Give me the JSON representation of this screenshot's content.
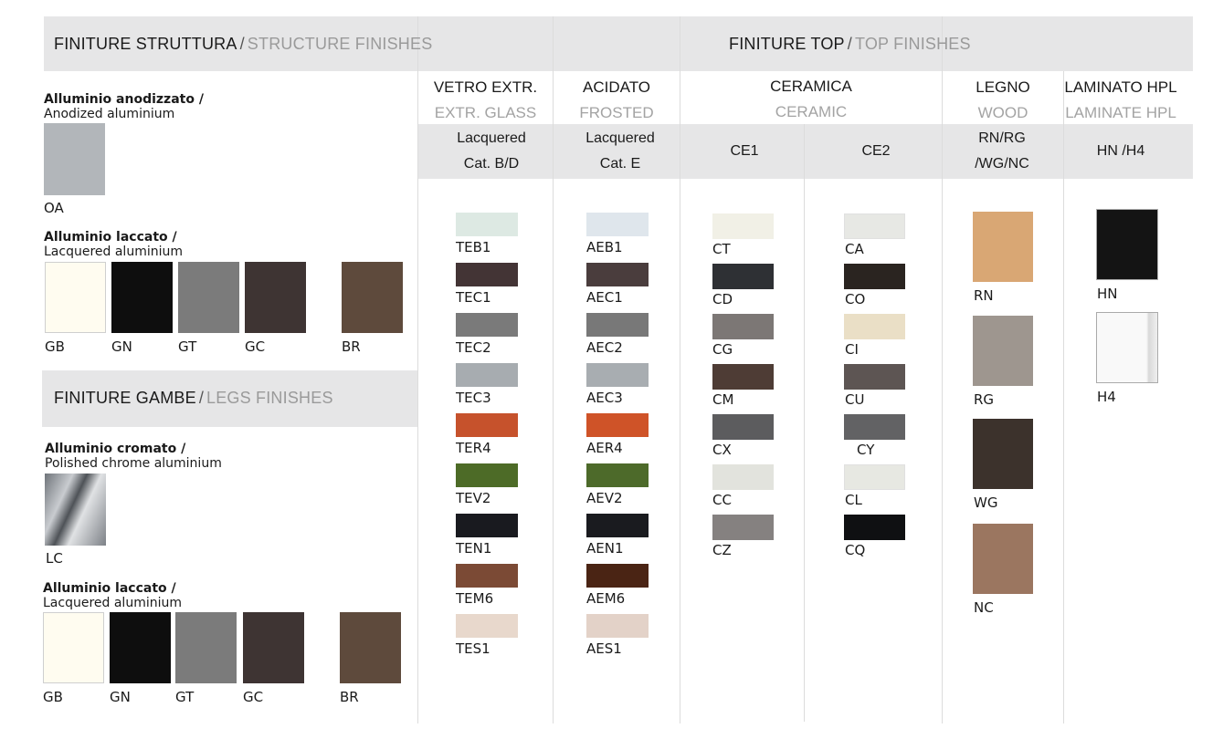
{
  "structure_header": {
    "it": "FINITURE STRUTTURA",
    "sep": "/",
    "en": "STRUCTURE FINISHES"
  },
  "legs_header": {
    "it": "FINITURE GAMBE",
    "sep": "/",
    "en": "LEGS FINISHES"
  },
  "top_header": {
    "it": "FINITURE TOP",
    "sep": "/",
    "en": "TOP FINISHES"
  },
  "groups": [
    {
      "it": "Alluminio anodizzato /",
      "en": "Anodized aluminium"
    },
    {
      "it": "Alluminio laccato /",
      "en": "Lacquered aluminium"
    },
    {
      "it": "Alluminio cromato /",
      "en": "Polished chrome aluminium"
    },
    {
      "it": "Alluminio laccato /",
      "en": "Lacquered aluminium"
    }
  ],
  "structure_swatches": [
    {
      "code": "OA",
      "color": "#b2b6ba"
    },
    {
      "code": "GB",
      "color": "#fffcf0"
    },
    {
      "code": "GN",
      "color": "#0e0e0e"
    },
    {
      "code": "GT",
      "color": "#7b7b7b"
    },
    {
      "code": "GC",
      "color": "#3e3433"
    },
    {
      "code": "BR",
      "color": "#5e4a3c"
    }
  ],
  "legs_swatches": [
    {
      "code": "LC",
      "color": "#8d9196"
    },
    {
      "code": "GB",
      "color": "#fffcf0"
    },
    {
      "code": "GN",
      "color": "#0e0e0e"
    },
    {
      "code": "GT",
      "color": "#7b7b7b"
    },
    {
      "code": "GC",
      "color": "#3e3433"
    },
    {
      "code": "BR",
      "color": "#5e4a3c"
    }
  ],
  "columns": [
    {
      "it": "VETRO EXTR.",
      "en": "EXTR. GLASS",
      "sub1": "Lacquered",
      "sub2": "Cat. B/D"
    },
    {
      "it": "ACIDATO",
      "en": "FROSTED",
      "sub1": "Lacquered",
      "sub2": "Cat. E"
    },
    {
      "it": "CERAMICA",
      "en": "CERAMIC",
      "sub1": "CE1",
      "sub2": "CE2"
    },
    {
      "it": "LEGNO",
      "en": "WOOD",
      "sub1": "RN/RG",
      "sub2": "/WG/NC"
    },
    {
      "it": "LAMINATO HPL",
      "en": "LAMINATE HPL",
      "sub1": "HN /H4",
      "sub2": ""
    }
  ],
  "glass": [
    {
      "code": "TEB1",
      "color": "#dde9e3"
    },
    {
      "code": "TEC1",
      "color": "#433435"
    },
    {
      "code": "TEC2",
      "color": "#7a7a7a"
    },
    {
      "code": "TEC3",
      "color": "#a7acb0"
    },
    {
      "code": "TER4",
      "color": "#c6522c"
    },
    {
      "code": "TEV2",
      "color": "#4d6b27"
    },
    {
      "code": "TEN1",
      "color": "#191a1f"
    },
    {
      "code": "TEM6",
      "color": "#7b4a35"
    },
    {
      "code": "TES1",
      "color": "#e8d8cc"
    }
  ],
  "frosted": [
    {
      "code": "AEB1",
      "color": "#dfe6ec"
    },
    {
      "code": "AEC1",
      "color": "#4a3d3d"
    },
    {
      "code": "AEC2",
      "color": "#787878"
    },
    {
      "code": "AEC3",
      "color": "#a8adb1"
    },
    {
      "code": "AER4",
      "color": "#cf5328"
    },
    {
      "code": "AEV2",
      "color": "#4d6a2a"
    },
    {
      "code": "AEN1",
      "color": "#1a1b1f"
    },
    {
      "code": "AEM6",
      "color": "#4a2414"
    },
    {
      "code": "AES1",
      "color": "#e3d2c8"
    }
  ],
  "ce1": [
    {
      "code": "CT",
      "color": "#f1f0e6"
    },
    {
      "code": "CD",
      "color": "#2e3034"
    },
    {
      "code": "CG",
      "color": "#7c7775"
    },
    {
      "code": "CM",
      "color": "#4e3c35"
    },
    {
      "code": "CX",
      "color": "#5c5c5e"
    },
    {
      "code": "CC",
      "color": "#e2e3dd"
    },
    {
      "code": "CZ",
      "color": "#858180"
    }
  ],
  "ce2": [
    {
      "code": "CA",
      "color": "#e7e8e4"
    },
    {
      "code": "CO",
      "color": "#2a2420"
    },
    {
      "code": "CI",
      "color": "#eadfc6"
    },
    {
      "code": "CU",
      "color": "#5d5553"
    },
    {
      "code": "CY",
      "color": "#626264"
    },
    {
      "code": "CL",
      "color": "#e7e8e2"
    },
    {
      "code": "CQ",
      "color": "#0f1012"
    }
  ],
  "wood": [
    {
      "code": "RN",
      "color": "#d9a774"
    },
    {
      "code": "RG",
      "color": "#9e968f"
    },
    {
      "code": "WG",
      "color": "#3c322c"
    },
    {
      "code": "NC",
      "color": "#9b7660"
    }
  ],
  "laminate": [
    {
      "code": "HN",
      "color": "#141414"
    },
    {
      "code": "H4",
      "color": "#f6f6f6"
    }
  ]
}
